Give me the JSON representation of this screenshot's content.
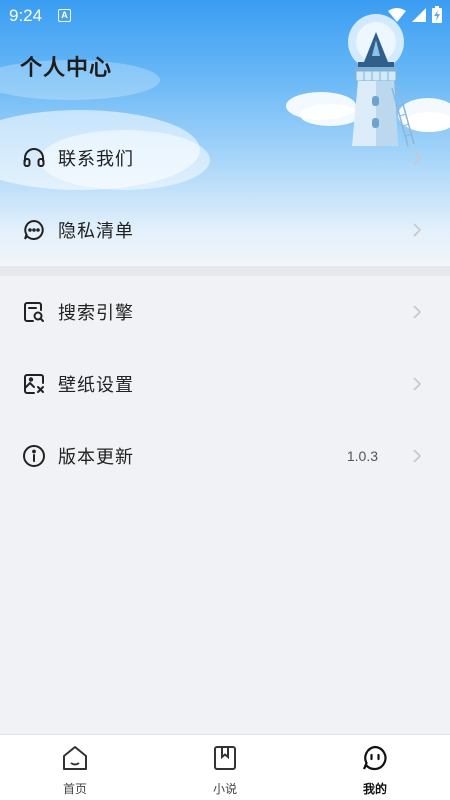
{
  "status": {
    "time": "9:24",
    "notif_letter": "A"
  },
  "header": {
    "title": "个人中心"
  },
  "menu": [
    {
      "label": "联系我们",
      "icon": "headset-icon"
    },
    {
      "label": "隐私清单",
      "icon": "chat-bubble-icon"
    },
    {
      "label": "搜索引擎",
      "icon": "search-document-icon"
    },
    {
      "label": "壁纸设置",
      "icon": "image-settings-icon"
    },
    {
      "label": "版本更新",
      "icon": "info-icon",
      "value": "1.0.3"
    }
  ],
  "tabbar": {
    "items": [
      {
        "label": "首页",
        "icon": "home-icon",
        "active": false
      },
      {
        "label": "小说",
        "icon": "book-icon",
        "active": false
      },
      {
        "label": "我的",
        "icon": "profile-face-icon",
        "active": true
      }
    ]
  },
  "colors": {
    "sky": "#3a9df2",
    "background": "#f1f2f6",
    "text": "#222222"
  }
}
